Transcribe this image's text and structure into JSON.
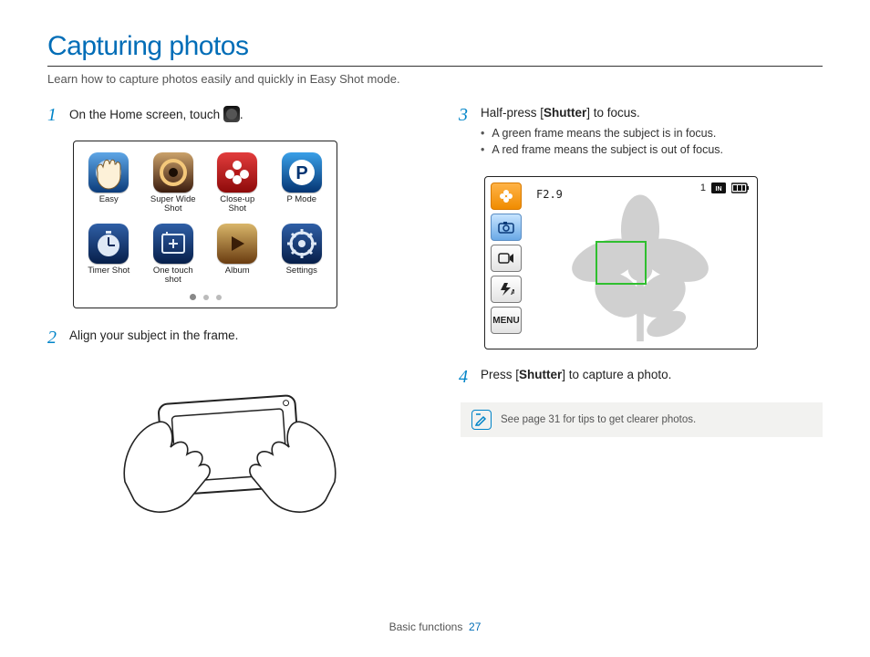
{
  "title": "Capturing photos",
  "subtitle": "Learn how to capture photos easily and quickly in Easy Shot mode.",
  "steps": {
    "s1": {
      "num": "1",
      "text_a": "On the Home screen, touch ",
      "text_b": "."
    },
    "s2": {
      "num": "2",
      "text": "Align your subject in the frame."
    },
    "s3": {
      "num": "3",
      "text_a": "Half-press [",
      "shutter": "Shutter",
      "text_b": "] to focus."
    },
    "s3_bullets": [
      "A green frame means the subject is in focus.",
      "A red frame means the subject is out of focus."
    ],
    "s4": {
      "num": "4",
      "text_a": "Press [",
      "shutter": "Shutter",
      "text_b": "] to capture a photo."
    }
  },
  "home_icons": [
    {
      "name": "easy",
      "label": "Easy"
    },
    {
      "name": "super-wide-shot",
      "label": "Super Wide Shot"
    },
    {
      "name": "close-up-shot",
      "label": "Close-up Shot"
    },
    {
      "name": "p-mode",
      "label": "P Mode"
    },
    {
      "name": "timer-shot",
      "label": "Timer Shot"
    },
    {
      "name": "one-touch-shot",
      "label": "One touch shot"
    },
    {
      "name": "album",
      "label": "Album"
    },
    {
      "name": "settings",
      "label": "Settings"
    }
  ],
  "lcd": {
    "fnumber": "F2.9",
    "count": "1",
    "menu": "MENU"
  },
  "note": "See page 31 for tips to get clearer photos.",
  "footer": {
    "section": "Basic functions",
    "page": "27"
  }
}
